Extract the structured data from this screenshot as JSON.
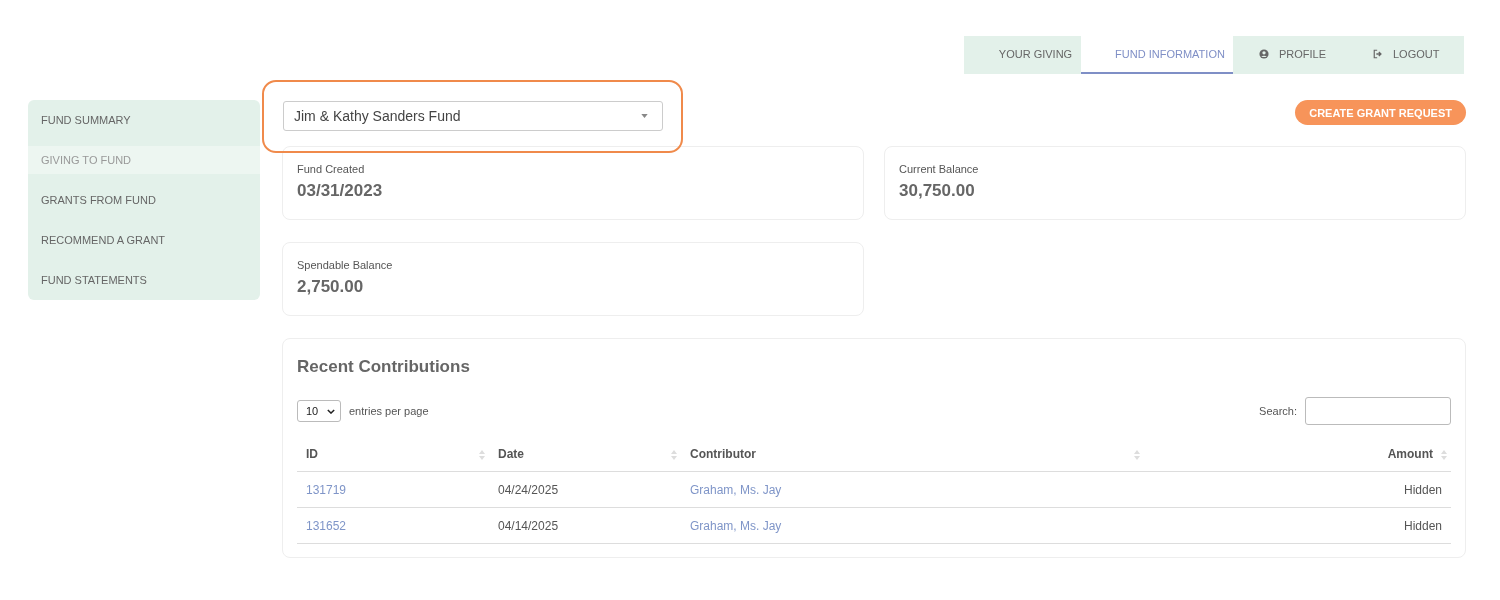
{
  "nav_tabs": [
    {
      "label": "YOUR GIVING",
      "selected": false
    },
    {
      "label": "FUND INFORMATION",
      "selected": true
    },
    {
      "label": "PROFILE",
      "selected": false
    },
    {
      "label": "LOGOUT",
      "selected": false
    }
  ],
  "sidebar": {
    "items": [
      {
        "label": "FUND SUMMARY",
        "selected": false
      },
      {
        "label": "GIVING TO FUND",
        "selected": true
      },
      {
        "label": "GRANTS FROM FUND",
        "selected": false
      },
      {
        "label": "RECOMMEND A GRANT",
        "selected": false
      },
      {
        "label": "FUND STATEMENTS",
        "selected": false
      }
    ]
  },
  "fund_select": {
    "value": "Jim & Kathy Sanders Fund",
    "highlighted": true
  },
  "create_button": "CREATE GRANT REQUEST",
  "stats": [
    {
      "label": "Fund Created",
      "value": "03/31/2023"
    },
    {
      "label": "Current Balance",
      "value": "30,750.00"
    },
    {
      "label": "Spendable Balance",
      "value": "2,750.00"
    }
  ],
  "contributions": {
    "title": "Recent Contributions",
    "page_size": "10",
    "page_size_label": "entries per page",
    "search_label": "Search:",
    "columns": [
      "ID",
      "Date",
      "Contributor",
      "Amount"
    ],
    "rows": [
      [
        "131719",
        "04/24/2025",
        "Graham, Ms. Jay",
        "Hidden"
      ],
      [
        "131652",
        "04/14/2025",
        "Graham, Ms. Jay",
        "Hidden"
      ]
    ]
  }
}
